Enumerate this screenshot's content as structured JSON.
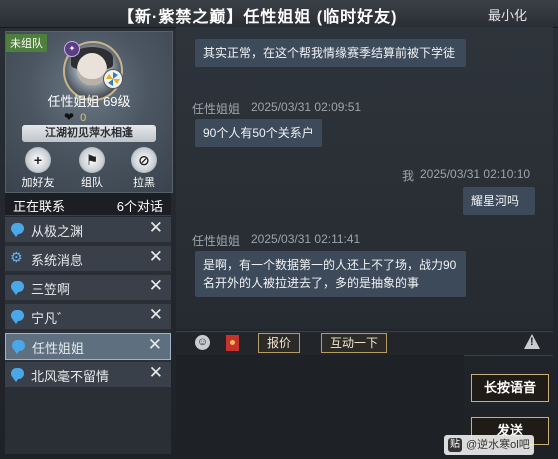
{
  "window": {
    "title": "【新·紫禁之巅】任性姐姐 (临时好友)",
    "minimize_label": "最小化"
  },
  "profile": {
    "status_badge": "未组队",
    "name_level": "任性姐姐  69级",
    "heart_count": "0",
    "motto": "江湖初见萍水相逢",
    "actions": [
      "加好友",
      "组队",
      "拉黑"
    ]
  },
  "contacts": {
    "header_left": "正在联系",
    "header_right": "6个对话",
    "items": [
      {
        "name": "从极之渊",
        "icon": "chat-bubble-icon",
        "selected": false
      },
      {
        "name": "系统消息",
        "icon": "gear-icon",
        "selected": false
      },
      {
        "name": "三笠啊",
        "icon": "chat-bubble-icon",
        "selected": false
      },
      {
        "name": "宁凡゛",
        "icon": "chat-bubble-icon",
        "selected": false
      },
      {
        "name": "任性姐姐",
        "icon": "chat-bubble-icon",
        "selected": true
      },
      {
        "name": "北风毫不留情",
        "icon": "chat-bubble-icon",
        "selected": false
      }
    ],
    "close_glyph": "✕"
  },
  "messages": [
    {
      "sender": "",
      "time": "",
      "text": "其实正常，在这个帮我情缘赛季结算前被下学徒",
      "side": "left"
    },
    {
      "sender": "任性姐姐",
      "time": "2025/03/31  02:09:51",
      "text": "90个人有50个关系户",
      "side": "left"
    },
    {
      "sender": "我",
      "time": "2025/03/31  02:10:10",
      "text": "耀星河吗",
      "side": "right"
    },
    {
      "sender": "任性姐姐",
      "time": "2025/03/31  02:11:41",
      "text": "是啊，有一个数据第一的人还上不了场，战力90名开外的人被拉进去了，多的是抽象的事",
      "side": "left"
    }
  ],
  "toolbar": {
    "quote_label": "报价",
    "interact_label": "互动一下"
  },
  "buttons": {
    "voice_label": "长按语音",
    "send_label": "发送"
  },
  "watermark": "@逆水寒ol吧",
  "colors": {
    "selected_item": "#5e7080",
    "bubble_bg": "#3d4a5a",
    "gold_border": "#c9b07a"
  }
}
